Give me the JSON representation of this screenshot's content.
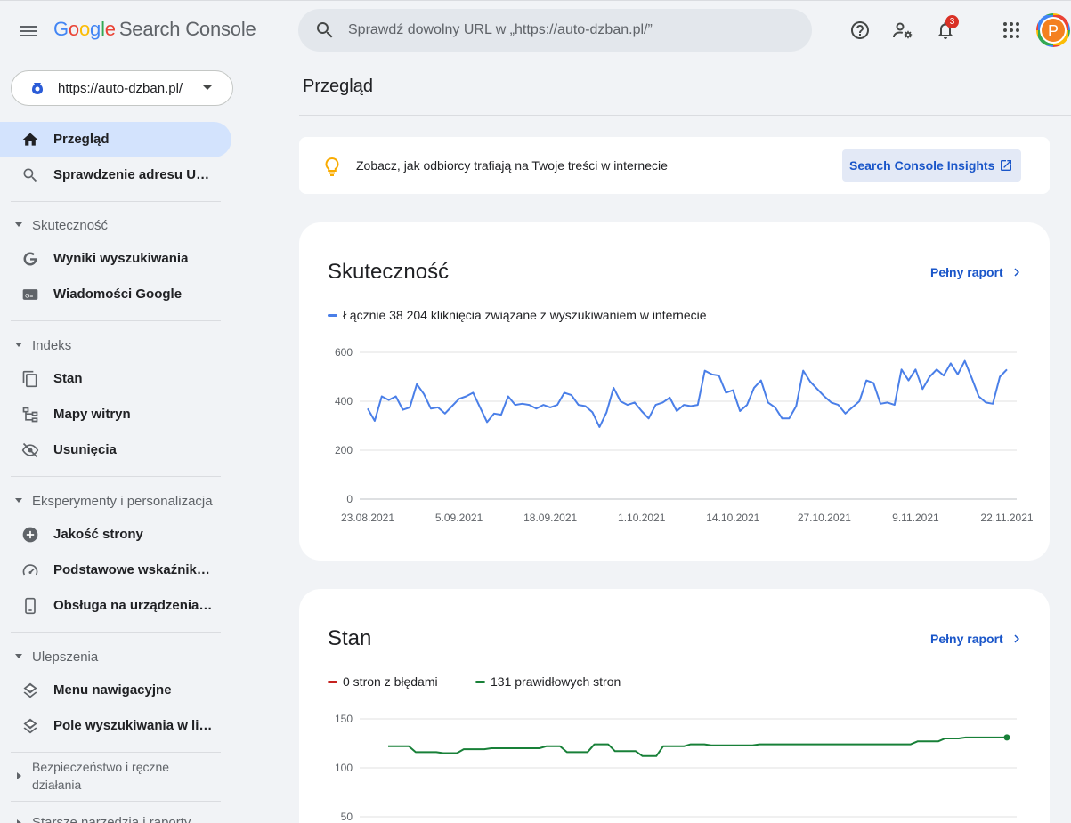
{
  "app": {
    "logo_letters": [
      "G",
      "o",
      "o",
      "g",
      "l",
      "e"
    ],
    "product": "Search Console",
    "search_placeholder": "Sprawdź dowolny URL w „https://auto-dzban.pl/”",
    "notification_count": "3",
    "avatar_letter": "P"
  },
  "property": {
    "url": "https://auto-dzban.pl/"
  },
  "sidebar": {
    "top_items": [
      {
        "label": "Przegląd",
        "icon": "home-icon",
        "active": true
      },
      {
        "label": "Sprawdzenie adresu URL",
        "icon": "search-icon",
        "active": false
      }
    ],
    "sections": [
      {
        "label": "Skuteczność",
        "items": [
          {
            "label": "Wyniki wyszukiwania",
            "icon": "google-g-icon"
          },
          {
            "label": "Wiadomości Google",
            "icon": "news-icon"
          }
        ]
      },
      {
        "label": "Indeks",
        "items": [
          {
            "label": "Stan",
            "icon": "copy-pages-icon"
          },
          {
            "label": "Mapy witryn",
            "icon": "sitemap-icon"
          },
          {
            "label": "Usunięcia",
            "icon": "eye-off-icon"
          }
        ]
      },
      {
        "label": "Eksperymenty i personalizacja",
        "items": [
          {
            "label": "Jakość strony",
            "icon": "plus-circle-icon"
          },
          {
            "label": "Podstawowe wskaźniki i...",
            "icon": "speedometer-icon"
          },
          {
            "label": "Obsługa na urządzeniac...",
            "icon": "phone-icon"
          }
        ]
      },
      {
        "label": "Ulepszenia",
        "items": [
          {
            "label": "Menu nawigacyjne",
            "icon": "layers-icon"
          },
          {
            "label": "Pole wyszukiwania w lin...",
            "icon": "layers-icon"
          }
        ]
      }
    ],
    "collapsed_sections": [
      {
        "label": "Bezpieczeństwo i ręczne działania"
      },
      {
        "label": "Starsze narzędzia i raporty"
      }
    ]
  },
  "main": {
    "page_title": "Przegląd",
    "insights": {
      "text": "Zobacz, jak odbiorcy trafiają na Twoje treści w internecie",
      "button_label": "Search Console Insights"
    },
    "performance_card": {
      "title": "Skuteczność",
      "full_report": "Pełny raport"
    },
    "coverage_card": {
      "title": "Stan",
      "full_report": "Pełny raport"
    }
  },
  "colors": {
    "accent_blue": "#4a7fe8",
    "error_red": "#c5221f",
    "valid_green": "#188038",
    "link_blue": "#1a56c9"
  },
  "chart_data": [
    {
      "type": "line",
      "series": [
        {
          "name": "Łącznie 38 204 kliknięcia związane z wyszukiwaniem w internecie",
          "color": "#4a7fe8",
          "values": [
            370,
            320,
            420,
            405,
            420,
            365,
            375,
            470,
            430,
            370,
            375,
            350,
            380,
            410,
            420,
            435,
            375,
            315,
            350,
            345,
            420,
            385,
            390,
            385,
            370,
            385,
            375,
            385,
            435,
            425,
            385,
            380,
            355,
            295,
            355,
            455,
            400,
            385,
            395,
            360,
            330,
            385,
            395,
            415,
            360,
            385,
            380,
            385,
            525,
            510,
            505,
            435,
            445,
            360,
            385,
            455,
            485,
            395,
            375,
            330,
            330,
            380,
            525,
            480,
            450,
            420,
            395,
            385,
            350,
            375,
            400,
            485,
            475,
            390,
            395,
            385,
            530,
            485,
            530,
            450,
            500,
            530,
            505,
            555,
            510,
            565,
            495,
            420,
            395,
            390,
            500,
            530
          ]
        }
      ],
      "x_tick_labels": [
        "23.08.2021",
        "5.09.2021",
        "18.09.2021",
        "1.10.2021",
        "14.10.2021",
        "27.10.2021",
        "9.11.2021",
        "22.11.2021"
      ],
      "y_tick_labels": [
        "600",
        "400",
        "200",
        "0"
      ],
      "ylim": [
        0,
        600
      ],
      "grid": true,
      "legend": "top-left"
    },
    {
      "type": "line",
      "series": [
        {
          "name": "0 stron z błędami",
          "color": "#c5221f",
          "values": []
        },
        {
          "name": "131 prawidłowych stron",
          "color": "#188038",
          "values": [
            122,
            122,
            122,
            122,
            116,
            116,
            116,
            116,
            115,
            115,
            115,
            119,
            119,
            119,
            119,
            120,
            120,
            120,
            120,
            120,
            120,
            120,
            120,
            122,
            122,
            122,
            116,
            116,
            116,
            116,
            124,
            124,
            124,
            117,
            117,
            117,
            117,
            112,
            112,
            112,
            122,
            122,
            122,
            122,
            124,
            124,
            124,
            123,
            123,
            123,
            123,
            123,
            123,
            123,
            124,
            124,
            124,
            124,
            124,
            124,
            124,
            124,
            124,
            124,
            124,
            124,
            124,
            124,
            124,
            124,
            124,
            124,
            124,
            124,
            124,
            124,
            124,
            127,
            127,
            127,
            127,
            130,
            130,
            130,
            131,
            131,
            131,
            131,
            131,
            131,
            131
          ]
        }
      ],
      "y_tick_labels": [
        "150",
        "100",
        "50"
      ],
      "ylim": [
        0,
        150
      ],
      "grid": true,
      "legend": "top-left"
    }
  ]
}
